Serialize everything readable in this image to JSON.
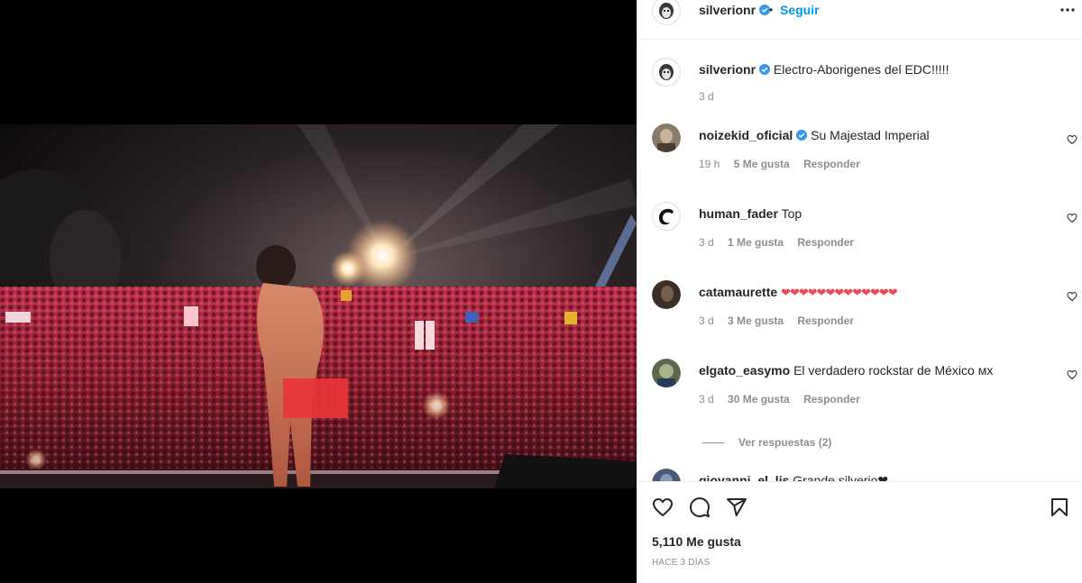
{
  "header": {
    "username": "silverionr",
    "dot": "•",
    "follow_label": "Seguir"
  },
  "caption": {
    "username": "silverionr",
    "text": "Electro-Aborigenes del EDC!!!!!",
    "time": "3 d"
  },
  "comments": [
    {
      "username": "noizekid_oficial",
      "verified": true,
      "text": "Su Majestad Imperial",
      "time": "19 h",
      "likes": "5 Me gusta",
      "reply": "Responder"
    },
    {
      "username": "human_fader",
      "verified": false,
      "text": "Top",
      "time": "3 d",
      "likes": "1 Me gusta",
      "reply": "Responder"
    },
    {
      "username": "catamaurette",
      "verified": false,
      "text": "❤❤❤❤❤❤❤❤❤❤❤❤❤",
      "time": "3 d",
      "likes": "3 Me gusta",
      "reply": "Responder"
    },
    {
      "username": "elgato_easymo",
      "verified": false,
      "text": "El verdadero rockstar de México ᴍx",
      "time": "3 d",
      "likes": "30 Me gusta",
      "reply": "Responder"
    }
  ],
  "view_replies": "Ver respuestas (2)",
  "partial_comment": {
    "username": "giovanni_el_lis",
    "text": "Grande silverio❤"
  },
  "footer": {
    "likes": "5,110 Me gusta",
    "ago": "HACE 3 DÍAS"
  },
  "colors": {
    "accent": "#0095f6",
    "verified": "#3897f0",
    "muted": "#8e8e8e",
    "heart_red": "#ed4956"
  },
  "icons": [
    "more-icon",
    "heart-icon",
    "comment-icon",
    "share-icon",
    "bookmark-icon",
    "verified-icon"
  ]
}
